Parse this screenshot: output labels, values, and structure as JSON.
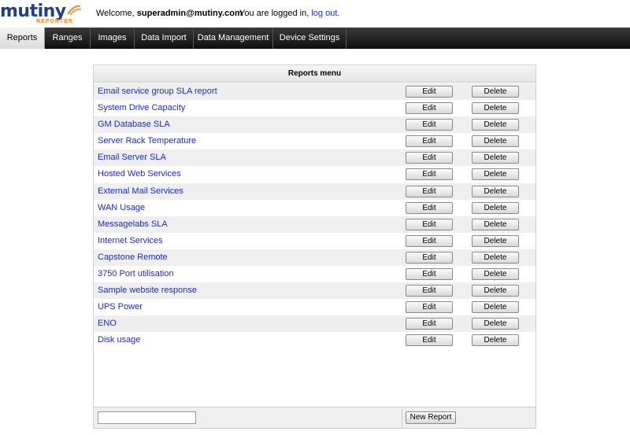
{
  "app": {
    "logo_text": "mutiny",
    "logo_subtext": "REPORTER",
    "welcome_prefix": "Welcome,",
    "username": "superadmin@mutiny.com",
    "logged_in_text": "You are logged in,",
    "logout_label": "log out."
  },
  "nav": {
    "tabs": [
      {
        "label": "Reports",
        "active": true
      },
      {
        "label": "Ranges"
      },
      {
        "label": "Images"
      },
      {
        "label": "Data Import"
      },
      {
        "label": "Data Management"
      },
      {
        "label": "Device Settings"
      }
    ]
  },
  "reports": {
    "title": "Reports menu",
    "edit_label": "Edit",
    "delete_label": "Delete",
    "items": [
      "Email service group SLA report",
      "System Drive Capacity",
      "GM Database SLA",
      "Server Rack Temperature",
      "Email Server SLA",
      "Hosted Web Services",
      "External Mail Services",
      "WAN Usage",
      "Messagelabs SLA",
      "Internet Services",
      "Capstone Remote",
      "3750 Port utilisation",
      "Sample website response",
      "UPS Power",
      "ENO",
      "Disk usage"
    ],
    "new_report_value": "",
    "new_report_label": "New Report"
  },
  "colors": {
    "link": "#1a2bd6",
    "nav_bg": "#1a1a1a",
    "brand_blue": "#1d3f8a",
    "brand_orange": "#f08a1c"
  }
}
